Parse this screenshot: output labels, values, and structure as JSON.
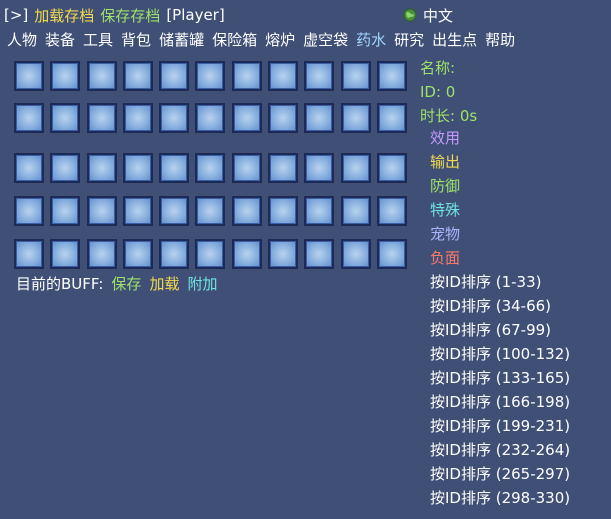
{
  "topbar": {
    "toggle_label": "[>]",
    "load_label": "加载存档",
    "save_label": "保存存档",
    "player_label": "[Player]",
    "language_label": "中文",
    "language_icon": "globe-icon"
  },
  "menu": {
    "items": [
      "人物",
      "装备",
      "工具",
      "背包",
      "储蓄罐",
      "保险箱",
      "熔炉",
      "虚空袋",
      "药水",
      "研究",
      "出生点",
      "帮助"
    ],
    "active_index": 8
  },
  "buff_grid": {
    "rows": 5,
    "columns": 11
  },
  "buff_bar": {
    "label": "目前的BUFF:",
    "save_label": "保存",
    "load_label": "加载",
    "append_label": "附加"
  },
  "info": {
    "name_label": "名称:",
    "id_label": "ID: 0",
    "duration_label": "时长: 0s"
  },
  "categories": [
    {
      "label": "效用",
      "color": "#c59bff"
    },
    {
      "label": "输出",
      "color": "#f2d94e"
    },
    {
      "label": "防御",
      "color": "#9ee36a"
    },
    {
      "label": "特殊",
      "color": "#6fe3e0"
    },
    {
      "label": "宠物",
      "color": "#a9b6ff"
    },
    {
      "label": "负面",
      "color": "#ff7a68"
    }
  ],
  "sorts": [
    "按ID排序 (1-33)",
    "按ID排序 (34-66)",
    "按ID排序 (67-99)",
    "按ID排序 (100-132)",
    "按ID排序 (133-165)",
    "按ID排序 (166-198)",
    "按ID排序 (199-231)",
    "按ID排序 (232-264)",
    "按ID排序 (265-297)",
    "按ID排序 (298-330)"
  ],
  "colors": {
    "background": "#3f4f75",
    "slot_border": "#1c2a55"
  }
}
